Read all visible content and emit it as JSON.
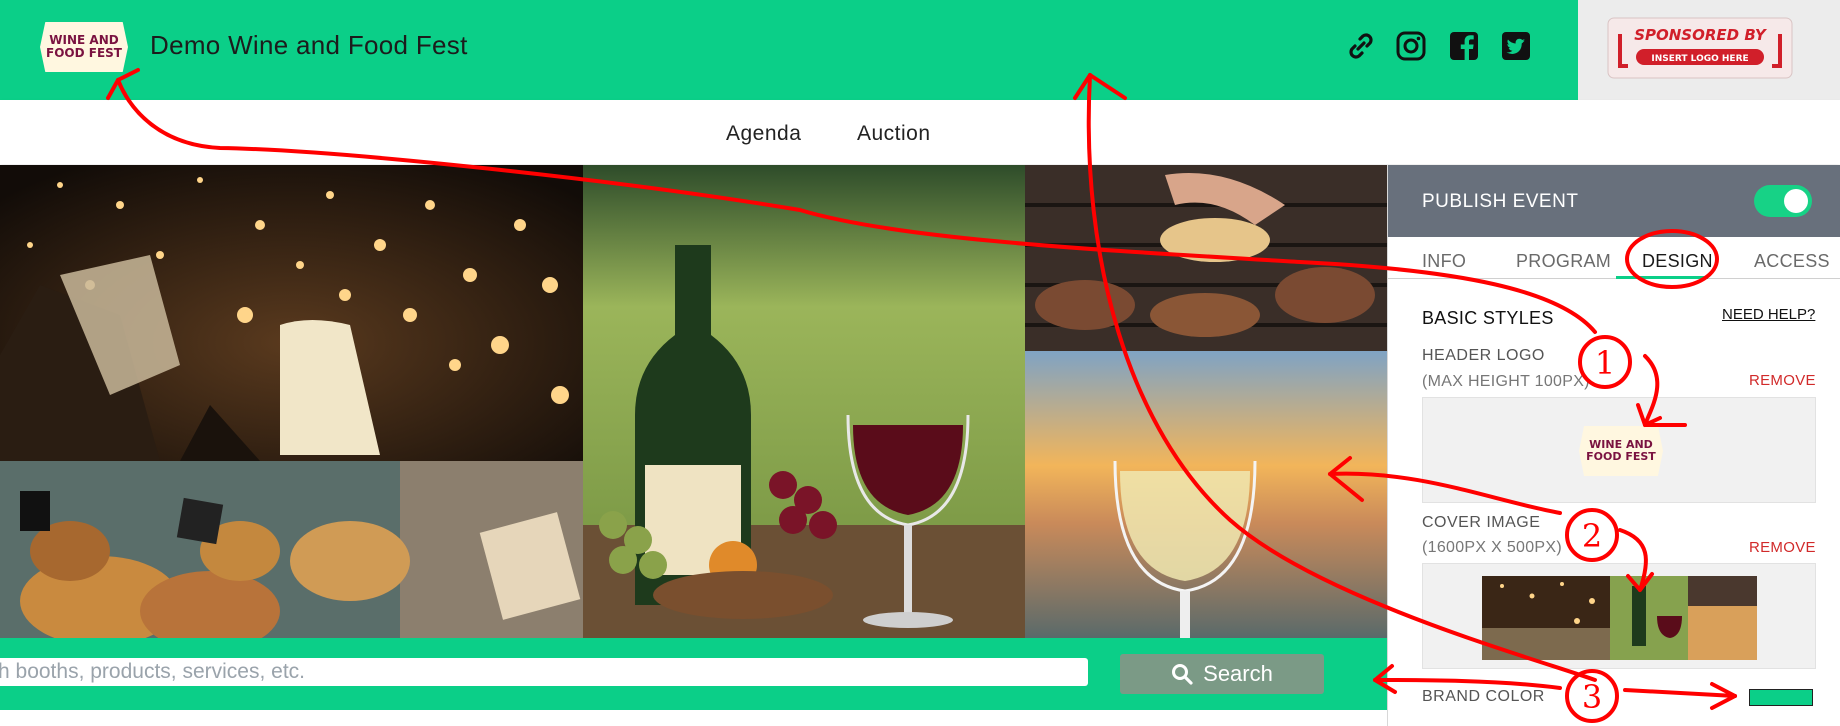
{
  "header": {
    "logo_line1": "WINE AND",
    "logo_line2": "FOOD FEST",
    "title": "Demo Wine and Food Fest",
    "social_icons": [
      "link-icon",
      "instagram-icon",
      "facebook-icon",
      "twitter-icon"
    ],
    "sponsor_line1": "SPONSORED BY",
    "sponsor_line2": "INSERT LOGO HERE"
  },
  "nav": {
    "items": [
      "Agenda",
      "Auction"
    ]
  },
  "search": {
    "placeholder": "h booths, products, services, etc.",
    "button_label": "Search"
  },
  "panel": {
    "publish_label": "PUBLISH EVENT",
    "publish_enabled": true,
    "tabs": [
      "INFO",
      "PROGRAM",
      "DESIGN",
      "ACCESS"
    ],
    "active_tab": "DESIGN",
    "section_title": "BASIC STYLES",
    "help_link": "NEED HELP?",
    "header_logo": {
      "label": "HEADER LOGO",
      "hint": "(MAX HEIGHT 100PX)",
      "remove": "REMOVE",
      "preview_line1": "WINE AND",
      "preview_line2": "FOOD FEST"
    },
    "cover_image": {
      "label": "COVER IMAGE",
      "hint": "(1600PX X 500PX)",
      "remove": "REMOVE"
    },
    "brand_color": {
      "label": "BRAND COLOR",
      "value": "#0bcf88"
    }
  },
  "annotations": {
    "markers": [
      "1",
      "2",
      "3"
    ]
  },
  "colors": {
    "brand": "#0bcf88",
    "header_bg": "#0bcf88",
    "publish_bar": "#68707c",
    "toggle_on": "#17d286",
    "remove_red": "#d12a2a",
    "annotation_red": "#ff0000",
    "search_button": "#7b9a86"
  }
}
